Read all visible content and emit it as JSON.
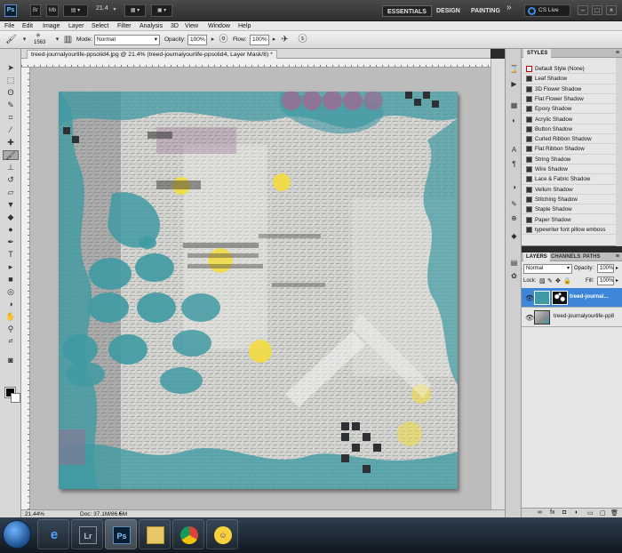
{
  "app": {
    "logo": "Ps",
    "zoom": "21.4",
    "workspaces": [
      "ESSENTIALS",
      "DESIGN",
      "PAINTING"
    ],
    "more": "»",
    "cs_live": "CS Live"
  },
  "menu": [
    "File",
    "Edit",
    "Image",
    "Layer",
    "Select",
    "Filter",
    "Analysis",
    "3D",
    "View",
    "Window",
    "Help"
  ],
  "options": {
    "brush_size": "1563",
    "mode_label": "Mode:",
    "mode_value": "Normal",
    "opacity_label": "Opacity:",
    "opacity_value": "100%",
    "flow_label": "Flow:",
    "flow_value": "100%"
  },
  "document": {
    "tab_title": "treed-journalyourlife-ppsolid4.jpg @ 21.4% (treed-journalyourlife-ppsolid4, Layer Mask/8) *",
    "status_zoom": "21.44%",
    "status_doc": "Doc: 37.1M/86.5M"
  },
  "styles_panel": {
    "tab": "STYLES",
    "items": [
      "Default Style (None)",
      "Leaf Shadow",
      "3D Flower Shadow",
      "Flat Flower Shadow",
      "Epoxy Shadow",
      "Acrylic Shadow",
      "Button Shadow",
      "Curled Ribbon Shadow",
      "Flat Ribbon Shadow",
      "String Shadow",
      "Wire Shadow",
      "Lace & Fabric Shadow",
      "Vellum Shadow",
      "Stitching Shadow",
      "Staple Shadow",
      "Paper Shadow",
      "typewriter font pillow emboss"
    ]
  },
  "layers_panel": {
    "tabs": [
      "LAYERS",
      "CHANNELS",
      "PATHS"
    ],
    "blend_mode": "Normal",
    "opacity_label": "Opacity:",
    "opacity_value": "100%",
    "lock_label": "Lock:",
    "fill_label": "Fill:",
    "fill_value": "100%",
    "layers": [
      {
        "name": "treed-journal...",
        "selected": true
      },
      {
        "name": "treed-journalyourlife-pp8",
        "selected": false
      }
    ]
  },
  "taskbar": {
    "apps": [
      "ie-icon",
      "lightroom-icon",
      "photoshop-icon",
      "explorer-icon",
      "chrome-icon",
      "yahoo-messenger-icon"
    ],
    "lr_label": "Lr",
    "ps_label": "Ps"
  },
  "colors": {
    "teal": "#3f9aa3",
    "yellow": "#f2dc3e",
    "purple": "#9a6c92",
    "selection": "#3d86d9"
  }
}
